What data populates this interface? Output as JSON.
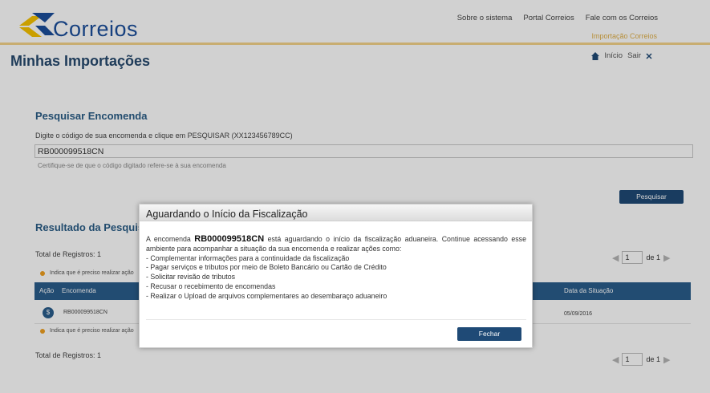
{
  "header": {
    "logo_text": "Correios",
    "links": [
      "Sobre o sistema",
      "Portal Correios",
      "Fale com os Correios"
    ],
    "subsite": "Importação Correios",
    "brand_colors": {
      "blue": "#1c4f9c",
      "yellow": "#f7c300"
    }
  },
  "page": {
    "title": "Minhas Importações",
    "user_links": {
      "inicio": "Início",
      "sair": "Sair"
    }
  },
  "search": {
    "title": "Pesquisar Encomenda",
    "instruction": "Digite o código de sua encomenda e clique em PESQUISAR (XX123456789CC)",
    "value": "RB000099518CN",
    "hint": "Certifique-se de que o código digitado refere-se à sua encomenda",
    "button": "Pesquisar"
  },
  "results": {
    "title": "Resultado da Pesquisa",
    "total_label": "Total de Registros: 1",
    "note": "Indica que é preciso realizar ação",
    "pager": {
      "page": "1",
      "of": "de 1"
    },
    "columns": [
      "Ação",
      "Encomenda",
      "Data da Situação"
    ],
    "rows": [
      {
        "code": "RB000099518CN",
        "date": "05/09/2016"
      }
    ]
  },
  "modal": {
    "title": "Aguardando o Início da Fiscalização",
    "intro_before": "A encomenda",
    "code": "RB000099518CN",
    "intro_after": "está aguardando o início da fiscalização aduaneira. Continue acessando esse ambiente para acompanhar a situação da sua encomenda e realizar ações como:",
    "items": [
      "- Complementar informações para a continuidade da fiscalização",
      "- Pagar serviços e tributos por meio de Boleto Bancário ou Cartão de Crédito",
      "- Solicitar revisão de tributos",
      "- Recusar o recebimento de encomendas",
      "- Realizar o Upload de arquivos complementares ao desembaraço aduaneiro"
    ],
    "close_button": "Fechar"
  }
}
